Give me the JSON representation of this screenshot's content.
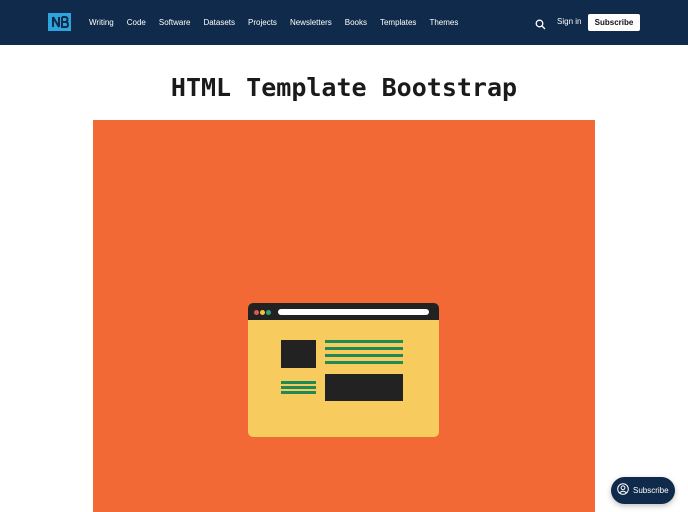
{
  "header": {
    "logo_icon": "ghost-logo-icon",
    "nav_items": [
      "Writing",
      "Code",
      "Software",
      "Datasets",
      "Projects",
      "Newsletters",
      "Books",
      "Templates",
      "Themes"
    ],
    "search_icon": "search-icon",
    "signin_label": "Sign in",
    "subscribe_label": "Subscribe",
    "background_color": "#0f2a4a"
  },
  "main": {
    "title": "HTML Template Bootstrap",
    "hero_image": {
      "icon": "browser-window-illustration",
      "background_color": "#f26935",
      "window_color": "#f7cb5d",
      "dot_colors": [
        "#e0584a",
        "#f5c142",
        "#2fa37a"
      ]
    }
  },
  "floating": {
    "subscribe_label": "Subscribe",
    "icon": "user-circle-icon"
  }
}
